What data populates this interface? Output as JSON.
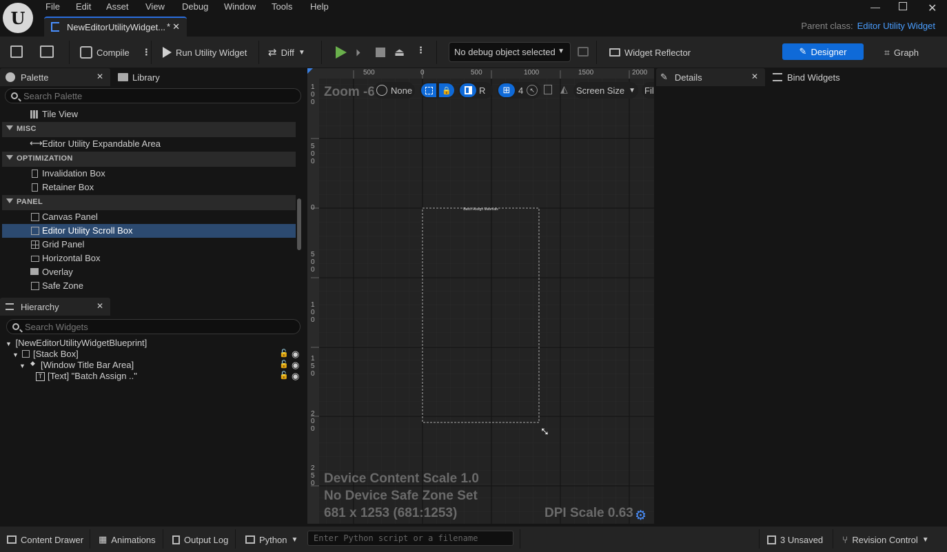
{
  "menu": {
    "items": [
      "File",
      "Edit",
      "Asset",
      "View",
      "Debug",
      "Window",
      "Tools",
      "Help"
    ],
    "asset_tab": "NewEditorUtilityWidget...",
    "asset_tab_modified": "*",
    "parent_class_label": "Parent class:",
    "parent_class_value": "Editor Utility Widget"
  },
  "toolbar": {
    "compile": "Compile",
    "run": "Run Utility Widget",
    "diff": "Diff",
    "debug_select": "No debug object selected",
    "widget_reflector": "Widget Reflector",
    "designer": "Designer",
    "graph": "Graph"
  },
  "palette": {
    "tab": "Palette",
    "library_tab": "Library",
    "search_placeholder": "Search Palette",
    "tile_view": "Tile View",
    "misc": "MISC",
    "misc_items": [
      "Editor Utility Expandable Area"
    ],
    "optimization": "OPTIMIZATION",
    "optimization_items": [
      "Invalidation Box",
      "Retainer Box"
    ],
    "panel": "PANEL",
    "panel_items": [
      "Canvas Panel",
      "Editor Utility Scroll Box",
      "Grid Panel",
      "Horizontal Box",
      "Overlay",
      "Safe Zone"
    ],
    "selected": "Editor Utility Scroll Box"
  },
  "hierarchy": {
    "tab": "Hierarchy",
    "search_placeholder": "Search Widgets",
    "root": "[NewEditorUtilityWidgetBlueprint]",
    "nodes": [
      "[Stack Box]",
      "[Window Title Bar Area]",
      "[Text] \"Batch Assign ..\""
    ]
  },
  "viewport": {
    "zoom": "Zoom -6",
    "none": "None",
    "r_label": "R",
    "grid_value": "4",
    "screen_size": "Screen Size",
    "fill": "Fil",
    "ruler_top": [
      "500",
      "0",
      "500",
      "1000",
      "1500",
      "2000"
    ],
    "ruler_left": [
      "1\n0\n0",
      "5\n0\n0",
      "0",
      "5\n0\n0",
      "1\n0\n0",
      "1\n5\n0",
      "2\n0\n0",
      "2\n5\n0"
    ],
    "widget_title": "Batch Assign Materials",
    "device_scale": "Device Content Scale 1.0",
    "safe_zone": "No Device Safe Zone Set",
    "resolution": "681 x 1253 (681:1253)",
    "dpi": "DPI Scale 0.63"
  },
  "details": {
    "tab": "Details",
    "bind_tab": "Bind Widgets"
  },
  "statusbar": {
    "content_drawer": "Content Drawer",
    "animations": "Animations",
    "output_log": "Output Log",
    "python": "Python",
    "python_placeholder": "Enter Python script or a filename",
    "unsaved": "3 Unsaved",
    "revision": "Revision Control"
  },
  "colors": {
    "accent": "#0f6ad8",
    "link": "#4a9eff",
    "selected_row": "#2c4a70",
    "play_green": "#6ab04c"
  }
}
